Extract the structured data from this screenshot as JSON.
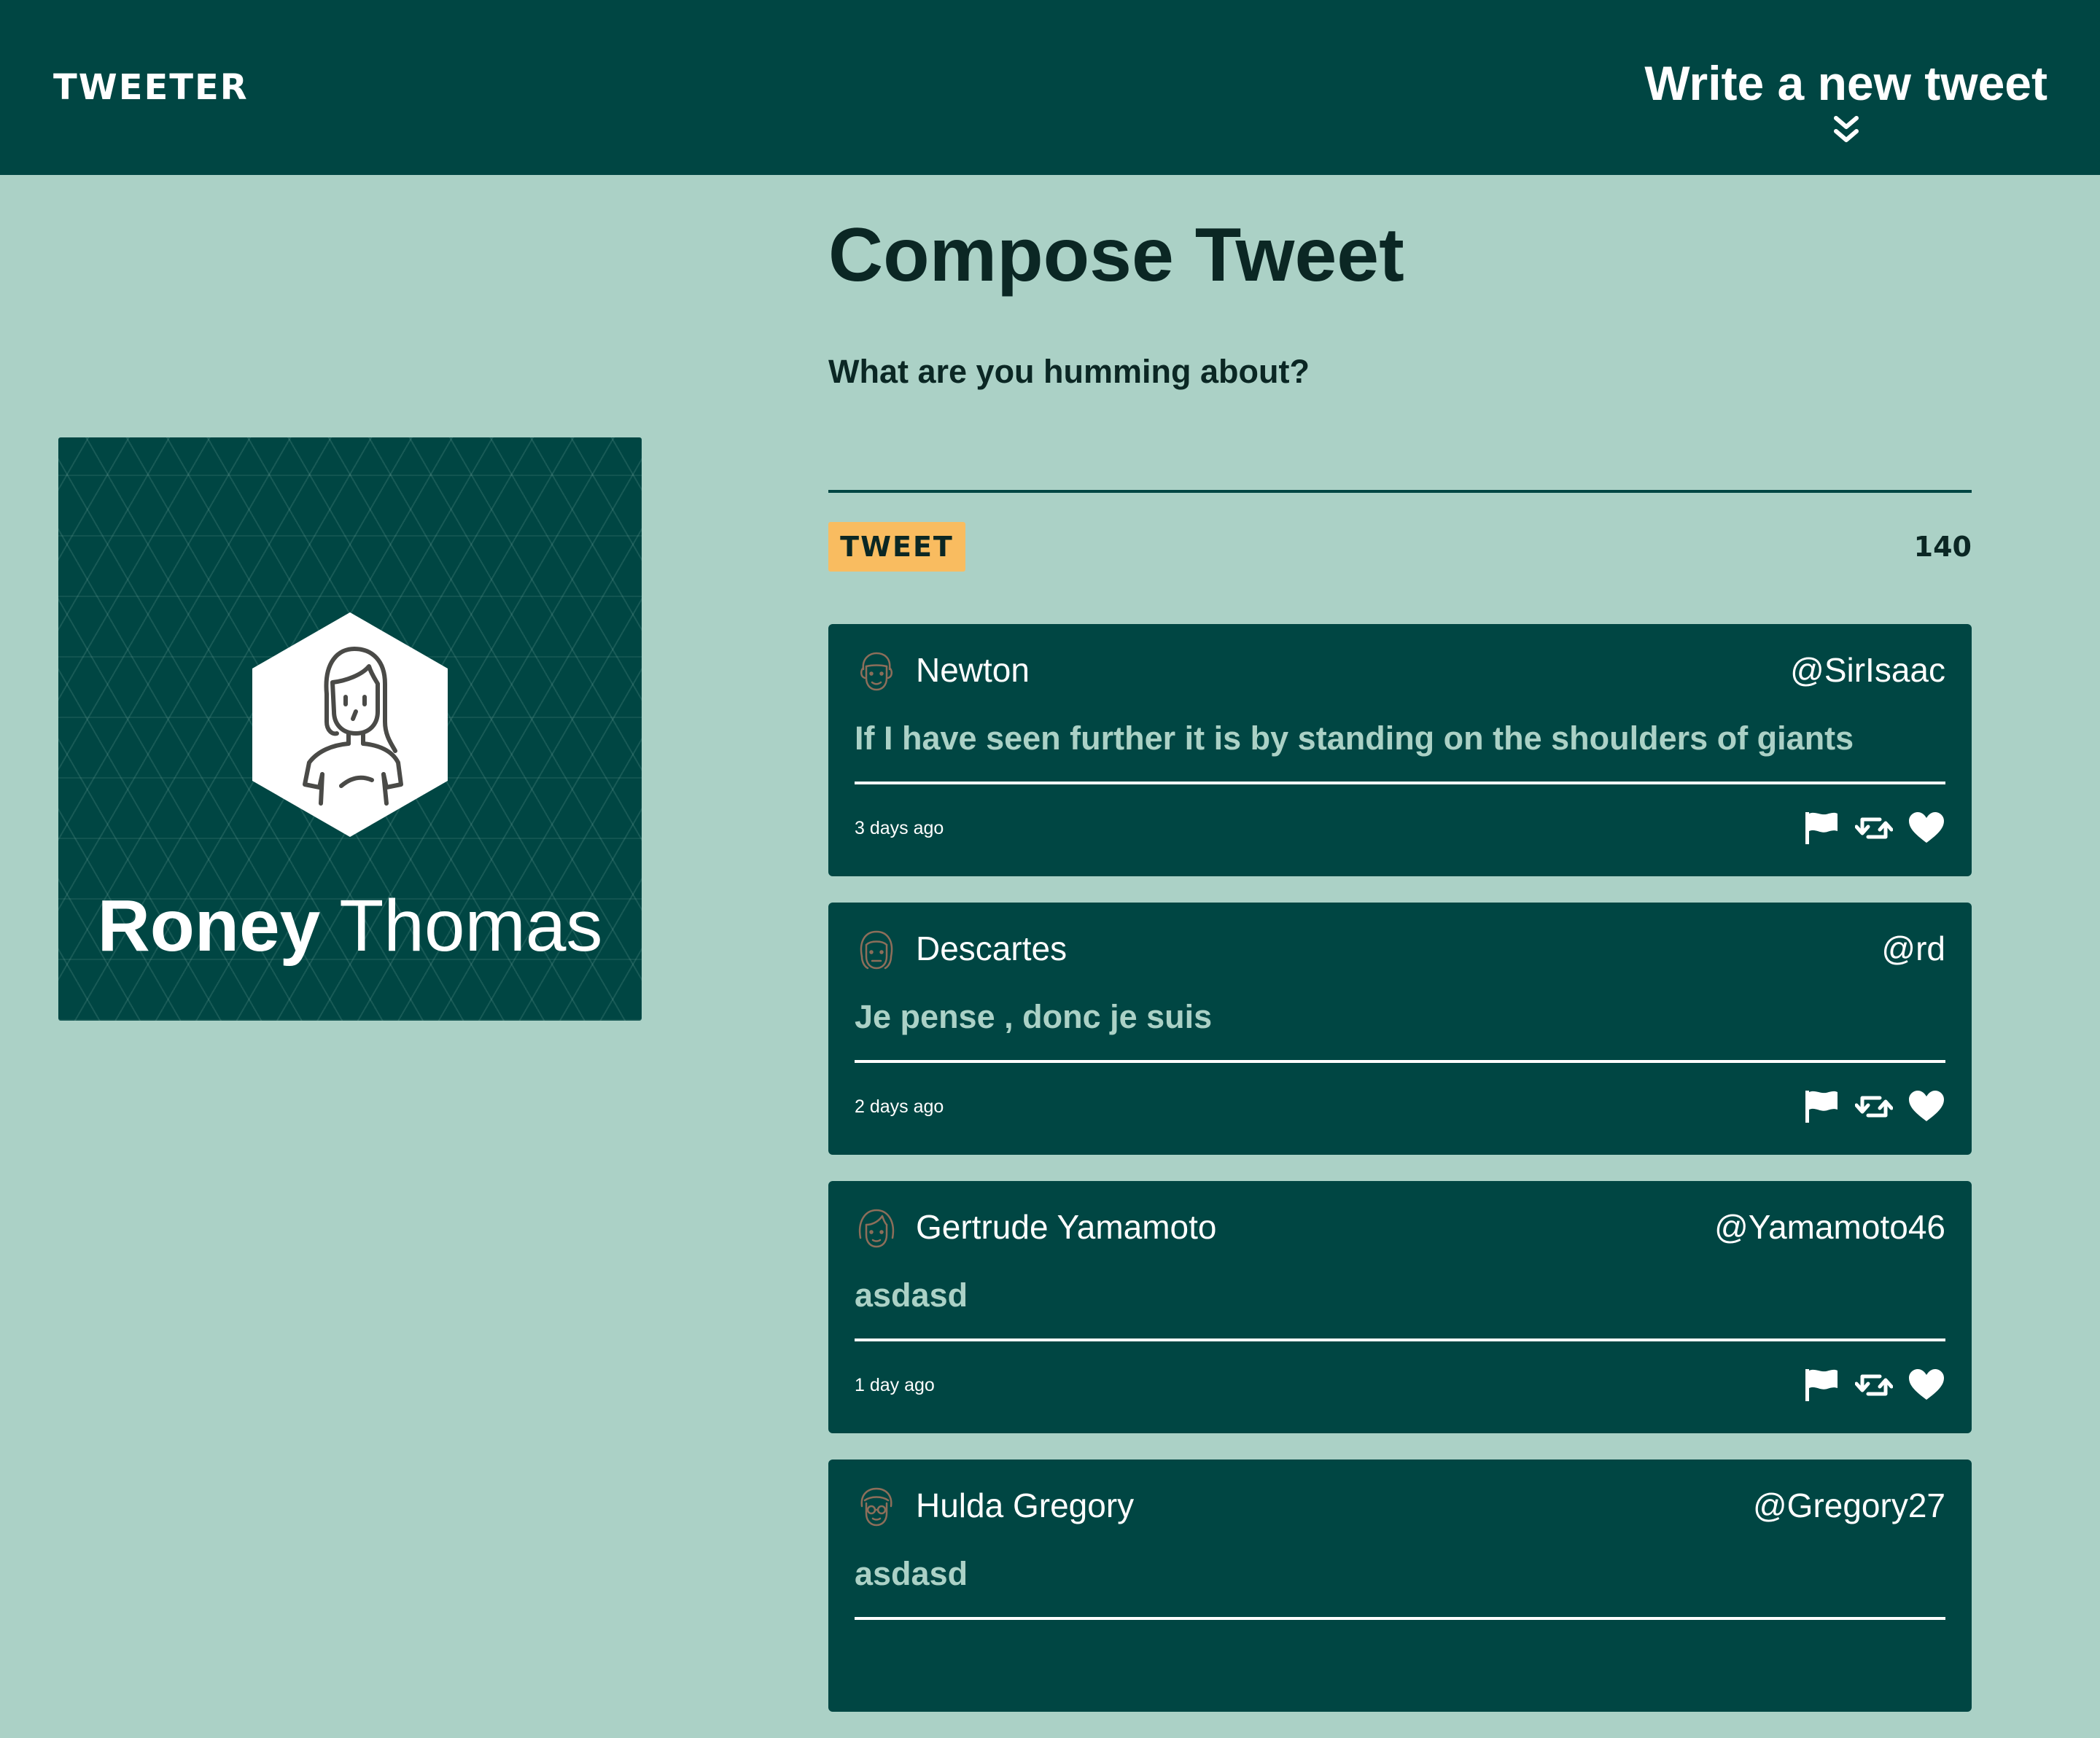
{
  "nav": {
    "brand": "TWEETER",
    "new_tweet_label": "Write a new tweet"
  },
  "profile": {
    "first_name": "Roney",
    "last_name": "Thomas"
  },
  "compose": {
    "title": "Compose Tweet",
    "label": "What are you humming about?",
    "input_value": "",
    "button_label": "TWEET",
    "counter": "140"
  },
  "tweets": [
    {
      "name": "Newton",
      "handle": "@SirIsaac",
      "text": "If I have seen further it is by standing on the shoulders of giants",
      "time": "3 days ago"
    },
    {
      "name": "Descartes",
      "handle": "@rd",
      "text": "Je pense , donc je suis",
      "time": "2 days ago"
    },
    {
      "name": "Gertrude Yamamoto",
      "handle": "@Yamamoto46",
      "text": "asdasd",
      "time": "1 day ago"
    },
    {
      "name": "Hulda Gregory",
      "handle": "@Gregory27",
      "text": "asdasd",
      "time": ""
    }
  ],
  "colors": {
    "background": "#abd1c6",
    "nav": "#004643",
    "card": "#004643",
    "accent_button": "#f9bc60",
    "tweet_text": "#abd1c6",
    "heading": "#0b2724"
  },
  "icons": {
    "nav_toggle": "double-chevron-down-icon",
    "flag": "flag-icon",
    "retweet": "retweet-icon",
    "like": "heart-icon",
    "profile_avatar": "user-avatar-icon"
  }
}
